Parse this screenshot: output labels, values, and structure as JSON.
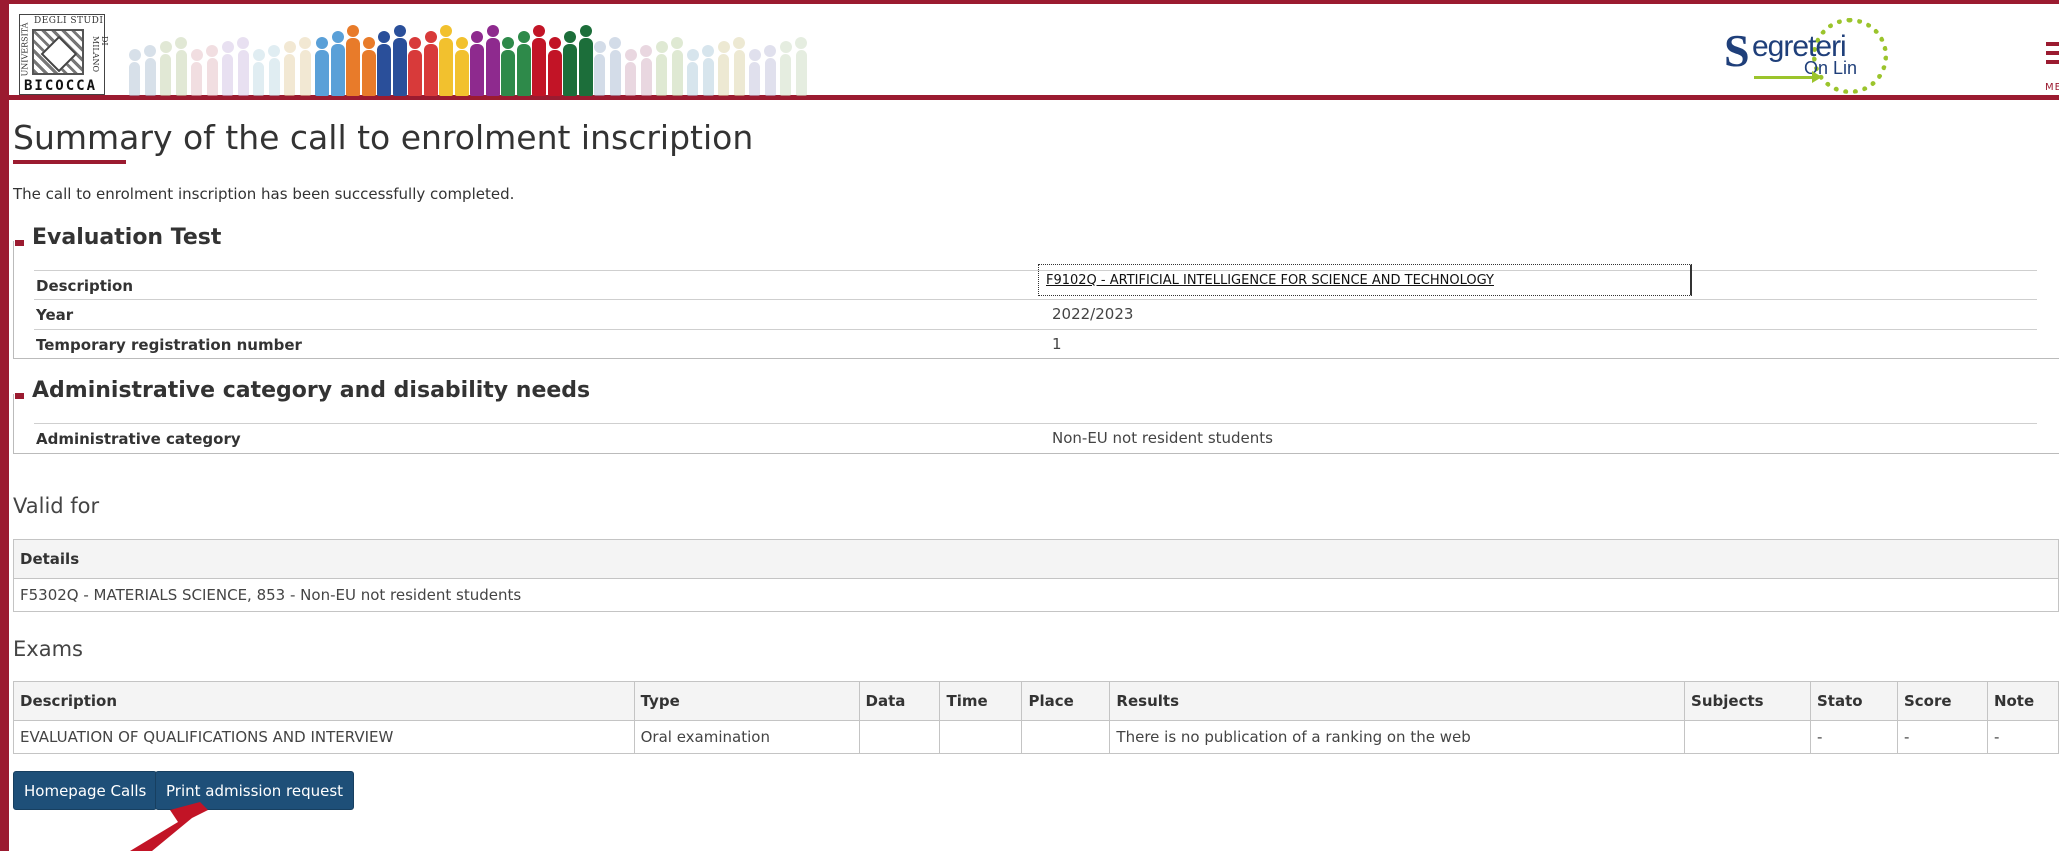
{
  "header": {
    "logo": {
      "name": "BICOCCA",
      "top_text": "DEGLI STUDI",
      "side_left": "UNIVERSITÀ",
      "side_right": "DI MILANO"
    },
    "brand": {
      "main": "egreteri",
      "initial": "S",
      "sub": "On Lin"
    },
    "menu_label": "MEN"
  },
  "page": {
    "title": "Summary of the call to enrolment inscription",
    "success_message": "The call to enrolment inscription has been successfully completed."
  },
  "evaluation_test": {
    "legend": "Evaluation Test",
    "rows": [
      {
        "label": "Description",
        "value": "F9102Q - ARTIFICIAL INTELLIGENCE FOR SCIENCE AND TECHNOLOGY"
      },
      {
        "label": "Year",
        "value": "2022/2023"
      },
      {
        "label": "Temporary registration number",
        "value": "1"
      }
    ]
  },
  "admin_category": {
    "legend": "Administrative category and disability needs",
    "rows": [
      {
        "label": "Administrative category",
        "value": "Non-EU not resident students"
      }
    ]
  },
  "valid_for": {
    "heading": "Valid for",
    "column": "Details",
    "value": "F5302Q - MATERIALS SCIENCE, 853 - Non-EU not resident students"
  },
  "exams": {
    "heading": "Exams",
    "columns": [
      "Description",
      "Type",
      "Data",
      "Time",
      "Place",
      "Results",
      "Subjects",
      "Stato",
      "Score",
      "Note"
    ],
    "rows": [
      [
        "EVALUATION OF QUALIFICATIONS AND INTERVIEW",
        "Oral examination",
        "",
        "",
        "",
        "There is no publication of a ranking on the web",
        "",
        "-",
        "-",
        "-"
      ]
    ]
  },
  "buttons": {
    "homepage": "Homepage Calls",
    "print": "Print admission request"
  },
  "colors": {
    "accent": "#9b1b30",
    "button": "#1e4f78",
    "brand_blue": "#1f3f7a",
    "brand_green": "#9bc42c"
  }
}
